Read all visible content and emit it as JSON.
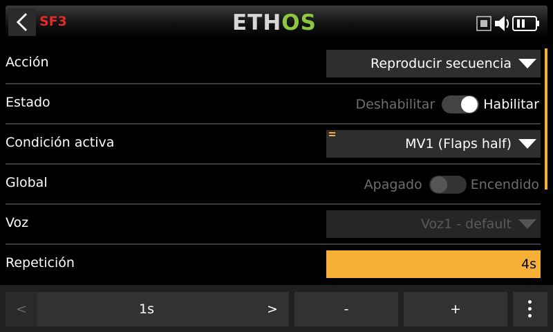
{
  "header": {
    "title": "SF3",
    "logo_left": "ETH",
    "logo_right": "OS",
    "icons": [
      "back-icon",
      "sd-card-icon",
      "speaker-icon",
      "battery-icon"
    ]
  },
  "form": {
    "rows": [
      {
        "label": "Acción",
        "value": "Reproducir secuencia"
      },
      {
        "label": "Estado",
        "off_label": "Deshabilitar",
        "on_label": "Habilitar",
        "state": "on"
      },
      {
        "label": "Condición activa",
        "value": "MV1 (Flaps half)"
      },
      {
        "label": "Global",
        "off_label": "Apagado",
        "on_label": "Encendido",
        "state": "off"
      },
      {
        "label": "Voz",
        "value": "Voz1 - default"
      },
      {
        "label": "Repetición",
        "value": "4s"
      }
    ]
  },
  "toolbar": {
    "prev_label": "<",
    "step_label": "1s",
    "next_label": ">",
    "minus_label": "-",
    "plus_label": "+"
  },
  "colors": {
    "accent": "#f7b036",
    "title_red": "#e62a2a",
    "logo_green": "#8dc63f"
  }
}
